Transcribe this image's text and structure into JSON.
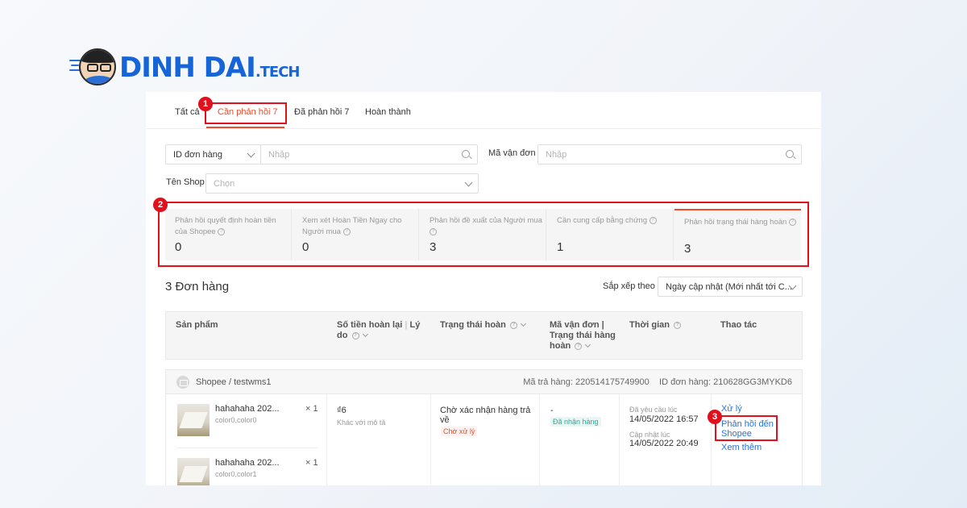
{
  "brand": {
    "name": "DINH DAI",
    "tld": ".TECH"
  },
  "tabs": [
    {
      "label": "Tất cả"
    },
    {
      "label": "Cần phản hồi 7"
    },
    {
      "label": "Đã phản hồi 7"
    },
    {
      "label": "Hoàn thành"
    }
  ],
  "filters": {
    "id_select": "ID đơn hàng",
    "id_placeholder": "Nhập",
    "tracking_label": "Mã vận đơn",
    "tracking_placeholder": "Nhập",
    "shop_label": "Tên Shop",
    "shop_placeholder": "Chọn"
  },
  "stats": [
    {
      "label": "Phản hồi quyết định hoàn tiền của Shopee",
      "value": "0"
    },
    {
      "label": "Xem xét Hoàn Tiền Ngay cho Người mua",
      "value": "0"
    },
    {
      "label": "Phản hồi đề xuất của Người mua",
      "value": "3"
    },
    {
      "label": "Cần cung cấp bằng chứng",
      "value": "1"
    },
    {
      "label": "Phản hồi trạng thái hàng hoàn",
      "value": "3"
    }
  ],
  "list": {
    "count_title": "3 Đơn hàng",
    "sort_label": "Sắp xếp theo",
    "sort_value": "Ngày cập nhật (Mới nhất tới C..."
  },
  "table": {
    "headers": {
      "product": "Sản phẩm",
      "refund_a": "Số tiền hoàn lại",
      "refund_b": "Lý",
      "refund_c": "do",
      "status": "Trạng thái hoàn",
      "tracking_a": "Mã vận đơn |",
      "tracking_b": "Trạng thái hàng",
      "tracking_c": "hoàn",
      "time": "Thời gian",
      "action": "Thao tác"
    }
  },
  "order": {
    "shop": "Shopee / testwms1",
    "return_code": "Mã trả hàng: 220514175749900",
    "order_id": "ID đơn hàng: 210628GG3MYKD6",
    "products": [
      {
        "name": "hahahaha 202...",
        "variant": "color0,color0",
        "qty": "× 1"
      },
      {
        "name": "hahahaha 202...",
        "variant": "color0,color1",
        "qty": "× 1"
      }
    ],
    "refund_amount": "₫6",
    "refund_reason": "Khác với mô tả",
    "status_line1": "Chờ xác nhận hàng trả",
    "status_line2": "về",
    "status_badge": "Chờ xử lý",
    "tracking": "-",
    "tracking_badge": "Đã nhận hàng",
    "requested_label": "Đã yêu cầu lúc",
    "requested_time": "14/05/2022 16:57",
    "updated_label": "Cập nhật lúc",
    "updated_time": "14/05/2022 20:49",
    "action_process": "Xử lý",
    "action_respond_1": "Phản hồi đến",
    "action_respond_2": "Shopee",
    "action_more": "Xem thêm"
  },
  "annotations": [
    "1",
    "2",
    "3"
  ],
  "colors": {
    "accent": "#ee4d2d",
    "highlight": "#e0101d",
    "link": "#2673dd",
    "brand": "#1565d8"
  }
}
